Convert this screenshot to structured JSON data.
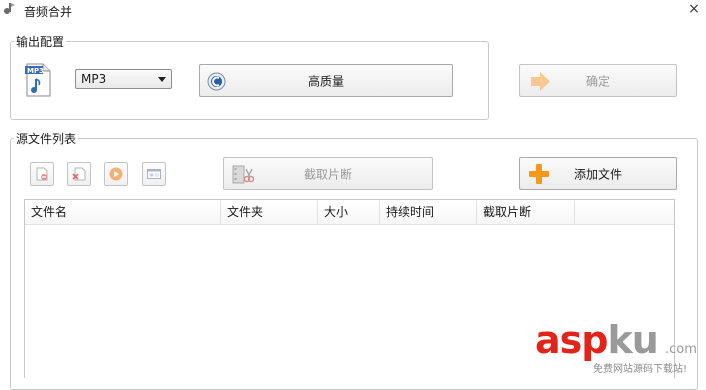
{
  "window": {
    "title": "音频合并",
    "close_label": "×"
  },
  "output_group": {
    "label": "输出配置",
    "format_icon_text": "MP3",
    "format_select": "MP3",
    "quality_button": "高质量",
    "ok_button": "确定"
  },
  "source_group": {
    "label": "源文件列表",
    "cut_button": "截取片断",
    "add_button": "添加文件"
  },
  "table": {
    "columns": [
      "文件名",
      "文件夹",
      "大小",
      "持续时间",
      "截取片断"
    ],
    "rows": []
  },
  "watermark": {
    "brand_red": "asp",
    "brand_grey": "ku",
    "suffix": ".com",
    "tagline": "免费网站源码下载站!"
  },
  "colors": {
    "accent_orange": "#f39a1e",
    "brand_red": "#e2231a"
  }
}
